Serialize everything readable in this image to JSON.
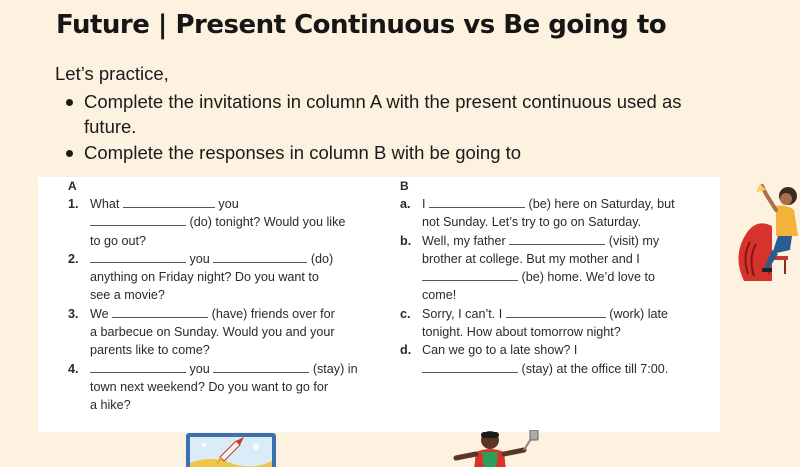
{
  "title": "Future | Present Continuous vs Be going to",
  "intro": "Let’s practice,",
  "bullets": [
    "Complete the invitations in column A with the present continuous used as future.",
    "Complete the responses in column B with be going to"
  ],
  "exercise": {
    "column_a": {
      "header": "A",
      "items": [
        {
          "num": "1.",
          "p1": "What",
          "p2": "you",
          "p3": "(do) tonight? Would you like",
          "p4": "to go out?"
        },
        {
          "num": "2.",
          "p1": "you",
          "p2": "(do)",
          "p3": "anything on Friday night? Do you want to",
          "p4": "see a movie?"
        },
        {
          "num": "3.",
          "p1": "We",
          "p2": "(have) friends over for",
          "p3": "a barbecue on Sunday. Would you and your",
          "p4": "parents like to come?"
        },
        {
          "num": "4.",
          "p1": "you",
          "p2": "(stay) in",
          "p3": "town next weekend? Do you want to go for",
          "p4": "a hike?"
        }
      ]
    },
    "column_b": {
      "header": "B",
      "items": [
        {
          "num": "a.",
          "p1": "I",
          "p2": "(be) here on Saturday, but",
          "p3": "not Sunday. Let’s try to go on Saturday."
        },
        {
          "num": "b.",
          "p1": "Well, my father",
          "p2": "(visit) my",
          "p3": "brother at college. But my mother and I",
          "p4": "(be) home. We’d love to",
          "p5": "come!"
        },
        {
          "num": "c.",
          "p1": "Sorry, I can’t. I",
          "p2": "(work) late",
          "p3": "tonight. How about tomorrow night?"
        },
        {
          "num": "d.",
          "p1": "Can we go to a late show? I",
          "p2": "(stay) at the office till 7:00."
        }
      ]
    }
  },
  "colors": {
    "background": "#fdf1df",
    "card": "#ffffff",
    "accent_red": "#d8322c",
    "accent_blue": "#2b5c8f"
  },
  "decorations": [
    "person-sitting-illustration",
    "rocket-picture-illustration",
    "chef-illustration"
  ]
}
